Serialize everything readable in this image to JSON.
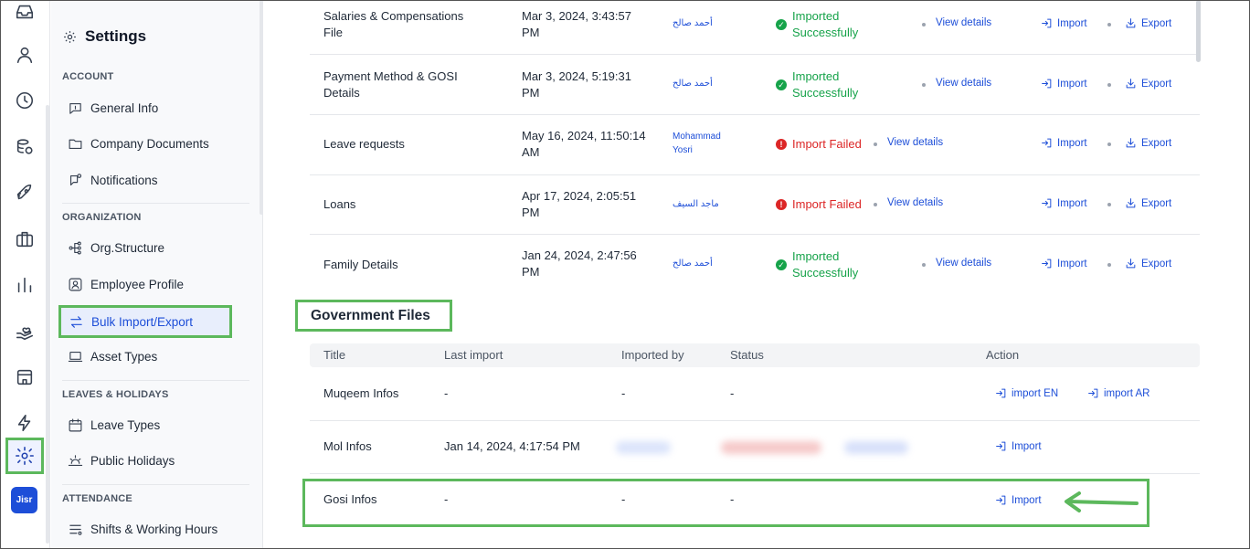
{
  "sidebar": {
    "title": "Settings",
    "sections": {
      "account": "ACCOUNT",
      "organization": "ORGANIZATION",
      "leaves": "LEAVES & HOLIDAYS",
      "attendance": "ATTENDANCE"
    },
    "items": {
      "general_info": "General Info",
      "company_documents": "Company Documents",
      "notifications": "Notifications",
      "org_structure": "Org.Structure",
      "employee_profile": "Employee Profile",
      "bulk_import_export": "Bulk Import/Export",
      "asset_types": "Asset Types",
      "leave_types": "Leave Types",
      "public_holidays": "Public Holidays",
      "shifts_working_hours": "Shifts & Working Hours"
    }
  },
  "rail": {
    "logo_text": "Jisr"
  },
  "files": [
    {
      "title_l1": "Salaries & Compensations",
      "title_l2": "File",
      "date_l1": "Mar 3, 2024, 3:43:57",
      "date_l2": "PM",
      "by": "أحمد صالح",
      "status_l1": "Imported",
      "status_l2": "Successfully",
      "view": "View details",
      "import": "Import",
      "export": "Export"
    },
    {
      "title_l1": "Payment Method & GOSI",
      "title_l2": "Details",
      "date_l1": "Mar 3, 2024, 5:19:31",
      "date_l2": "PM",
      "by": "أحمد صالح",
      "status_l1": "Imported",
      "status_l2": "Successfully",
      "view": "View details",
      "import": "Import",
      "export": "Export"
    },
    {
      "title": "Leave requests",
      "date_l1": "May 16, 2024, 11:50:14",
      "date_l2": "AM",
      "by_l1": "Mohammad",
      "by_l2": "Yosri",
      "status": "Import Failed",
      "view": "View details",
      "import": "Import",
      "export": "Export"
    },
    {
      "title": "Loans",
      "date_l1": "Apr 17, 2024, 2:05:51",
      "date_l2": "PM",
      "by": "ماجد السيف",
      "status": "Import Failed",
      "view": "View details",
      "import": "Import",
      "export": "Export"
    },
    {
      "title": "Family Details",
      "date_l1": "Jan 24, 2024, 2:47:56",
      "date_l2": "PM",
      "by": "أحمد صالح",
      "status_l1": "Imported",
      "status_l2": "Successfully",
      "view": "View details",
      "import": "Import",
      "export": "Export"
    }
  ],
  "government": {
    "title": "Government Files",
    "headers": {
      "title": "Title",
      "last_import": "Last import",
      "imported_by": "Imported by",
      "status": "Status",
      "action": "Action"
    },
    "rows": [
      {
        "title": "Muqeem Infos",
        "last_import": "-",
        "imported_by": "-",
        "status": "-",
        "action1": "import EN",
        "action2": "import AR"
      },
      {
        "title": "Mol Infos",
        "last_import": "Jan 14, 2024, 4:17:54 PM",
        "action1": "Import"
      },
      {
        "title": "Gosi Infos",
        "last_import": "-",
        "imported_by": "-",
        "status": "-",
        "action1": "Import"
      }
    ]
  },
  "colors": {
    "accent": "#1d4ed8",
    "success": "#16a34a",
    "danger": "#dc2626",
    "highlight": "#5cb85c"
  }
}
